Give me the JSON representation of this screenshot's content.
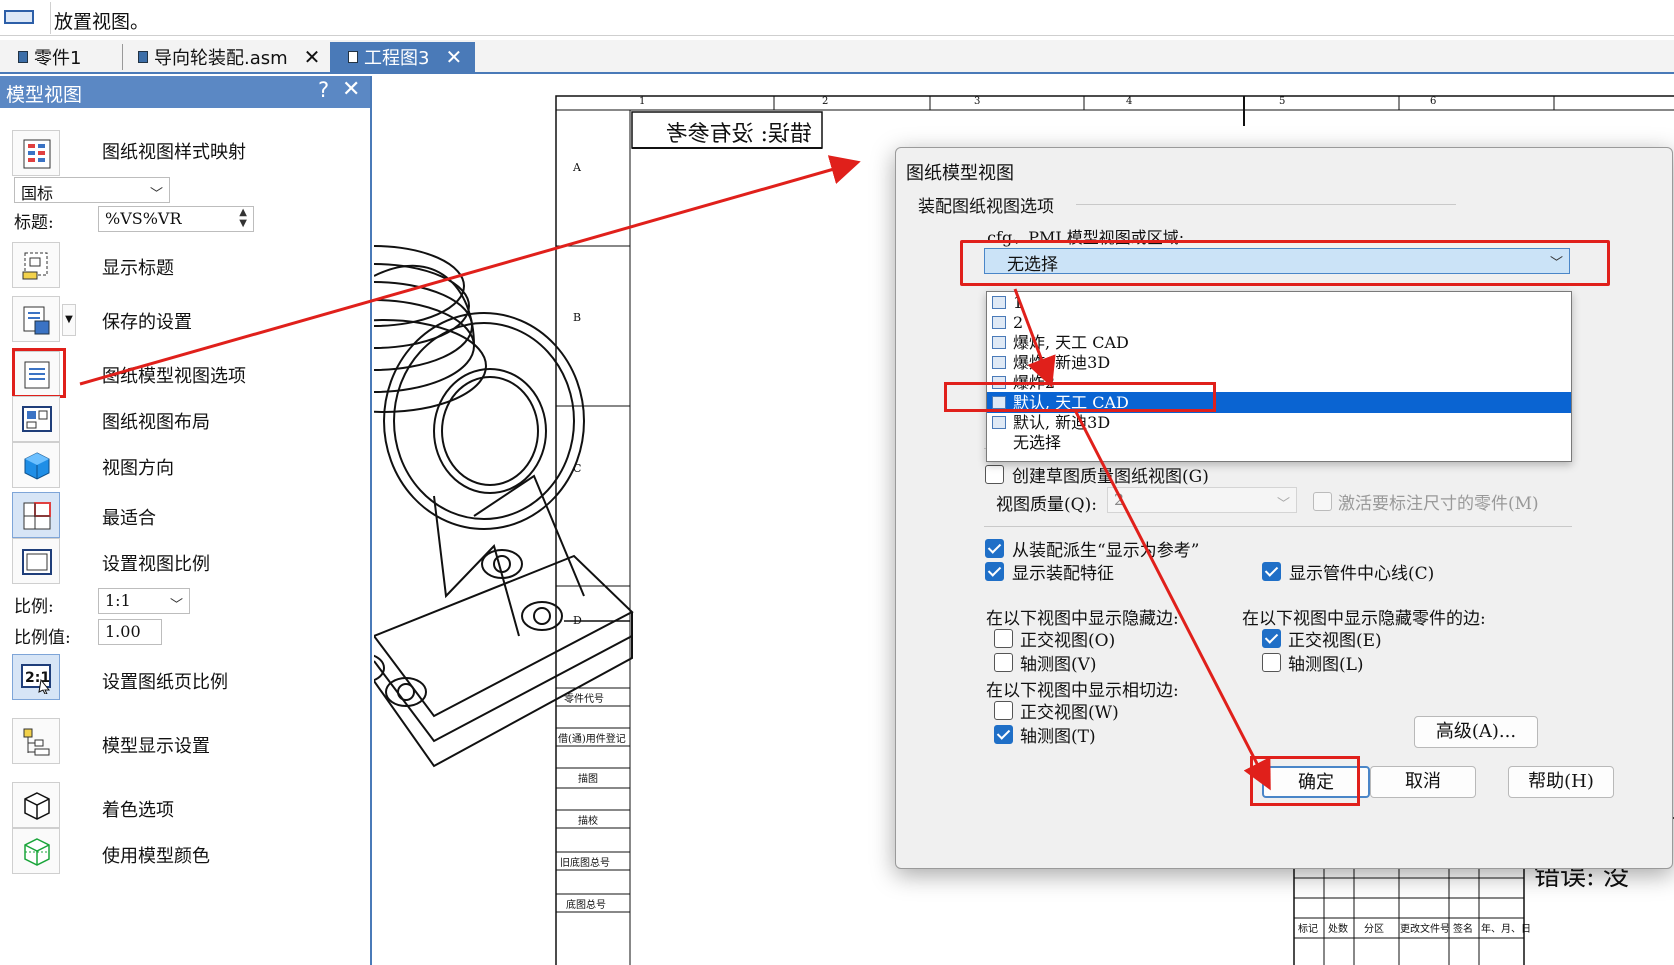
{
  "topbar": {
    "prompt": "放置视图。"
  },
  "tabs": [
    {
      "label": "零件1",
      "close": "✕"
    },
    {
      "label": "导向轮装配.asm",
      "close": "✕"
    },
    {
      "label": "工程图3",
      "close": "✕"
    }
  ],
  "panel": {
    "title": "模型视图",
    "help": "?",
    "close": "✕",
    "items": [
      "图纸视图样式映射",
      "显示标题",
      "保存的设置",
      "图纸模型视图选项",
      "图纸视图布局",
      "视图方向",
      "最适合",
      "设置视图比例",
      "设置图纸页比例",
      "模型显示设置",
      "着色选项",
      "使用模型颜色"
    ],
    "standard_value": "国标",
    "caption_label": "标题:",
    "caption_value": "%VS%VR",
    "scale_label": "比例:",
    "scale_value": "1:1",
    "scale_value_label": "比例值:",
    "scale_value_num": "1.00"
  },
  "drawing": {
    "title_block_text": "错误: 没有参考",
    "col_numbers": [
      "1",
      "2",
      "3",
      "4",
      "5",
      "6"
    ],
    "row_letters": [
      "A",
      "B",
      "C",
      "D"
    ],
    "side_labels": [
      "零件代号",
      "借(通)用件登记",
      "描图",
      "描校",
      "旧底图总号",
      "底图总号"
    ],
    "bottom_labels": [
      "标记",
      "处数",
      "分区",
      "更改文件号",
      "签名",
      "年、月、日"
    ],
    "right_text": "错误: 没"
  },
  "dialog": {
    "title": "图纸模型视图",
    "group_title": "装配图纸视图选项",
    "cfg_label": ".cfg、PMI 模型视图或区域:",
    "dropdown_value": "无选择",
    "dropdown_options": [
      "1",
      "2",
      "爆炸, 天工 CAD",
      "爆炸, 新迪3D",
      "爆炸2",
      "默认, 天工 CAD",
      "默认, 新迪3D",
      "无选择"
    ],
    "draft_quality_label": "创建草图质量图纸视图(G)",
    "view_quality_label": "视图质量(Q):",
    "view_quality_value": "2",
    "activate_label": "激活要标注尺寸的零件(M)",
    "derive_label": "从装配派生“显示为参考”",
    "show_features_label": "显示装配特征",
    "show_centerline_label": "显示管件中心线(C)",
    "hidden_edges_title": "在以下视图中显示隐藏边:",
    "hidden_edges_ortho": "正交视图(O)",
    "hidden_edges_iso": "轴测图(V)",
    "hidden_parts_title": "在以下视图中显示隐藏零件的边:",
    "hidden_parts_ortho": "正交视图(E)",
    "hidden_parts_iso": "轴测图(L)",
    "tangent_title": "在以下视图中显示相切边:",
    "tangent_ortho": "正交视图(W)",
    "tangent_iso": "轴测图(T)",
    "advanced_label": "高级(A)...",
    "ok_label": "确定",
    "cancel_label": "取消",
    "help_label": "帮助(H)"
  },
  "colors": {
    "accent": "#4a7ab8",
    "highlight": "#0a64d2",
    "annotation": "#e0201b"
  }
}
